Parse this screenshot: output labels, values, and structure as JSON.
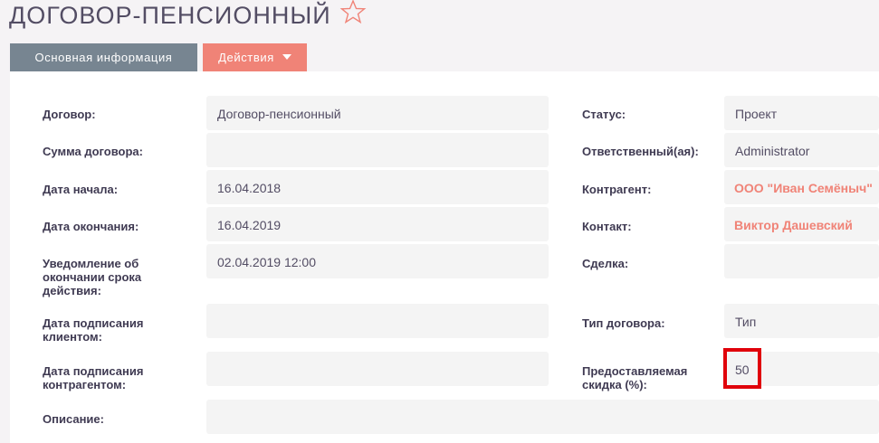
{
  "page": {
    "title": "ДОГОВОР-ПЕНСИОННЫЙ"
  },
  "tabs": {
    "main_label": "Основная информация",
    "actions_label": "Действия"
  },
  "left_fields": [
    {
      "label": "Договор:",
      "value": "Договор-пенсионный"
    },
    {
      "label": "Сумма договора:",
      "value": ""
    },
    {
      "label": "Дата начала:",
      "value": "16.04.2018"
    },
    {
      "label": "Дата окончания:",
      "value": "16.04.2019"
    },
    {
      "label": "Уведомление об окончании срока действия:",
      "value": "02.04.2019 12:00"
    },
    {
      "label": "Дата подписания клиентом:",
      "value": ""
    },
    {
      "label": "Дата подписания контрагентом:",
      "value": ""
    },
    {
      "label": "Описание:",
      "value": ""
    }
  ],
  "right_fields": [
    {
      "label": "Статус:",
      "value": "Проект"
    },
    {
      "label": "Ответственный(ая):",
      "value": "Administrator"
    },
    {
      "label": "Контрагент:",
      "value": "ООО \"Иван Семёныч\""
    },
    {
      "label": "Контакт:",
      "value": "Виктор Дашевский"
    },
    {
      "label": "Сделка:",
      "value": ""
    },
    {
      "label": "Тип договора:",
      "value": "Тип"
    },
    {
      "label": "Предоставляемая скидка (%):",
      "value": "50"
    }
  ],
  "colors": {
    "accent": "#f08377",
    "tab_main": "#778591",
    "highlight": "#e0000a"
  }
}
